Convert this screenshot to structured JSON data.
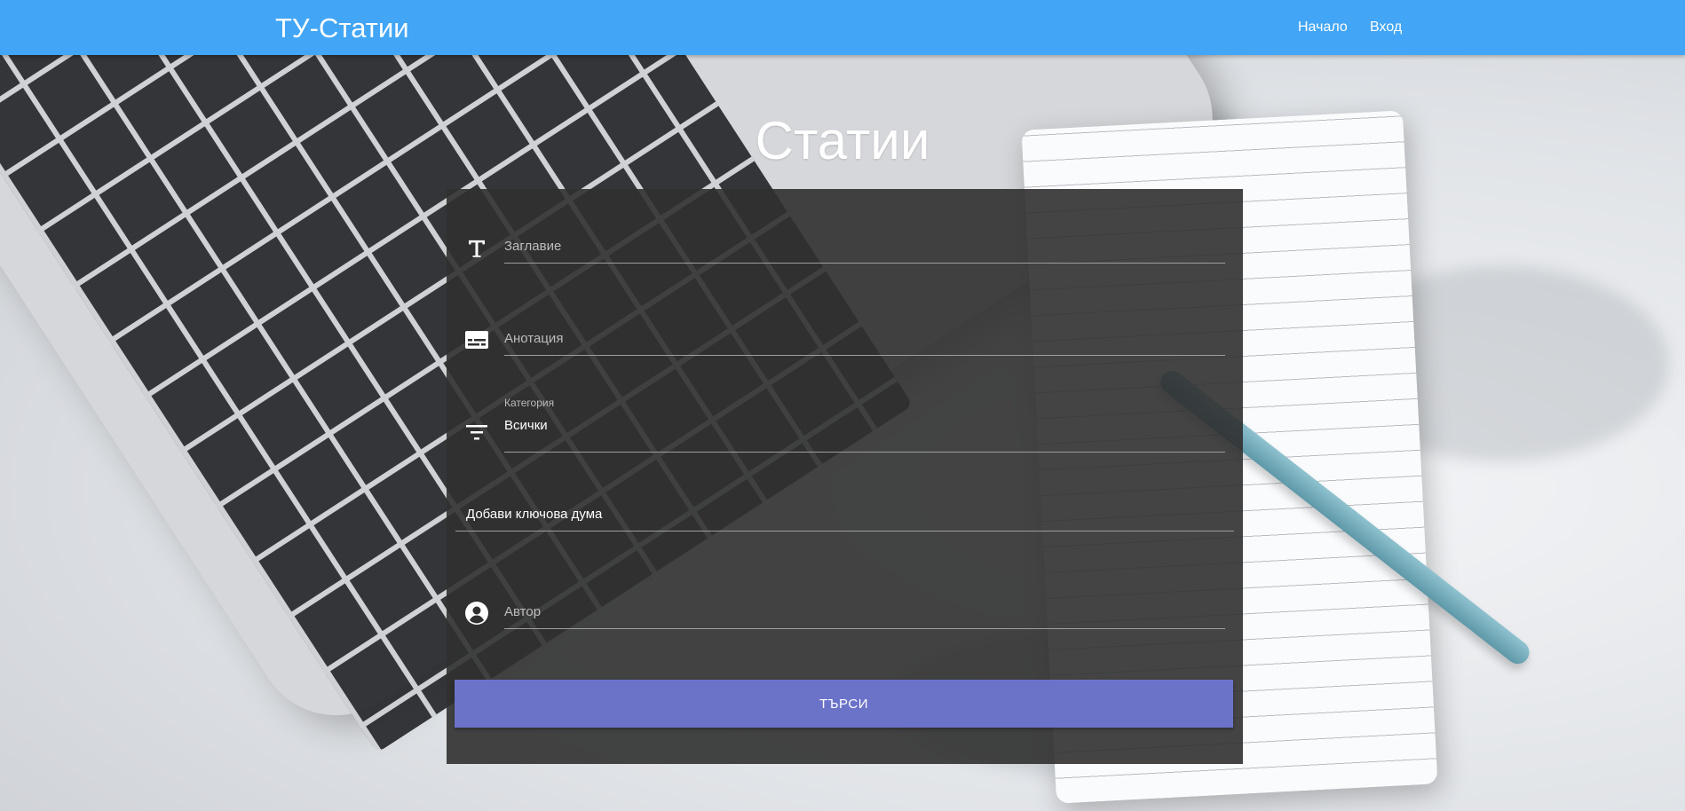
{
  "navbar": {
    "brand": "ТУ-Статии",
    "links": [
      {
        "label": "Начало"
      },
      {
        "label": "Вход"
      }
    ],
    "color": "#42a5f5"
  },
  "main": {
    "title": "Статии"
  },
  "search_form": {
    "title_field": {
      "placeholder": "Заглавие",
      "value": "",
      "icon": "title-text-icon"
    },
    "abstract_field": {
      "placeholder": "Анотация",
      "value": "",
      "icon": "subtitles-icon"
    },
    "category_field": {
      "label": "Категория",
      "value": "Всички",
      "icon": "filter-icon"
    },
    "keywords_field": {
      "placeholder": "Добави ключова дума",
      "value": ""
    },
    "author_field": {
      "placeholder": "Автор",
      "value": "",
      "icon": "account-circle-icon"
    },
    "submit_label": "ТЪРСИ",
    "submit_color": "#6b73c9"
  }
}
